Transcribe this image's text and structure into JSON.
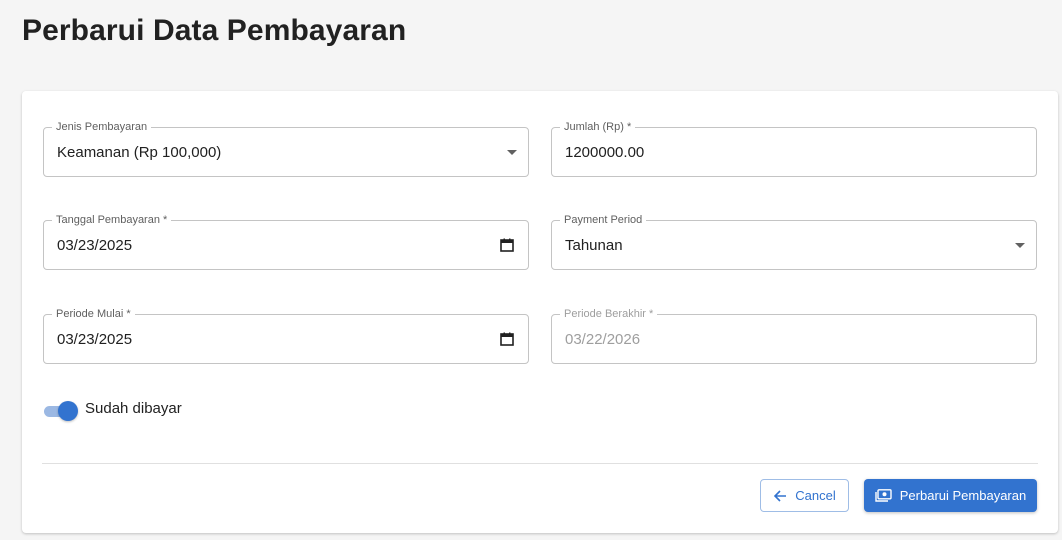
{
  "page": {
    "title": "Perbarui Data Pembayaran"
  },
  "form": {
    "payment_type": {
      "label": "Jenis Pembayaran",
      "value": "Keamanan (Rp 100,000)"
    },
    "amount": {
      "label": "Jumlah (Rp) *",
      "value": "1200000.00"
    },
    "payment_date": {
      "label": "Tanggal Pembayaran *",
      "value": "03/23/2025"
    },
    "payment_period": {
      "label": "Payment Period",
      "value": "Tahunan"
    },
    "period_start": {
      "label": "Periode Mulai *",
      "value": "03/23/2025"
    },
    "period_end": {
      "label": "Periode Berakhir *",
      "value": "03/22/2026"
    },
    "paid_toggle": {
      "label": "Sudah dibayar",
      "checked": true
    }
  },
  "actions": {
    "cancel_label": "Cancel",
    "submit_label": "Perbarui Pembayaran"
  },
  "colors": {
    "primary": "#3273cf",
    "toggle_track": "#9bb8e3",
    "border": "#c4c4c4",
    "page_bg": "#f5f5f5"
  },
  "icons": {
    "payment_type_caret": "caret-down-icon",
    "payment_date_calendar": "calendar-icon",
    "payment_period_caret": "caret-down-icon",
    "period_start_calendar": "calendar-icon",
    "cancel": "arrow-left-icon",
    "submit": "payment-icon"
  }
}
